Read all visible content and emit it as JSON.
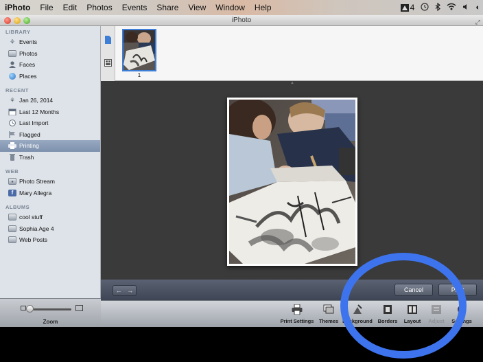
{
  "menubar": {
    "app": "iPhoto",
    "items": [
      "File",
      "Edit",
      "Photos",
      "Events",
      "Share",
      "View",
      "Window",
      "Help"
    ],
    "status_text": "4"
  },
  "window": {
    "title": "iPhoto"
  },
  "sidebar": {
    "sections": [
      {
        "heading": "LIBRARY",
        "items": [
          {
            "label": "Events",
            "icon": "palm-tree-icon"
          },
          {
            "label": "Photos",
            "icon": "photos-icon"
          },
          {
            "label": "Faces",
            "icon": "faces-icon"
          },
          {
            "label": "Places",
            "icon": "globe-icon"
          }
        ]
      },
      {
        "heading": "RECENT",
        "items": [
          {
            "label": "Jan 26, 2014",
            "icon": "palm-tree-icon"
          },
          {
            "label": "Last 12 Months",
            "icon": "calendar-icon"
          },
          {
            "label": "Last Import",
            "icon": "clock-icon"
          },
          {
            "label": "Flagged",
            "icon": "flag-icon"
          },
          {
            "label": "Printing",
            "icon": "printer-icon",
            "selected": true
          },
          {
            "label": "Trash",
            "icon": "trash-icon"
          }
        ]
      },
      {
        "heading": "WEB",
        "items": [
          {
            "label": "Photo Stream",
            "icon": "photo-stream-icon"
          },
          {
            "label": "Mary Allegra",
            "icon": "facebook-icon"
          }
        ]
      },
      {
        "heading": "ALBUMS",
        "items": [
          {
            "label": "cool stuff",
            "icon": "album-icon"
          },
          {
            "label": "Sophia Age 4",
            "icon": "album-icon"
          },
          {
            "label": "Web Posts",
            "icon": "album-icon"
          }
        ]
      }
    ],
    "zoom_label": "Zoom"
  },
  "filmstrip": {
    "thumb_number": "1"
  },
  "navbar": {
    "cancel_label": "Cancel",
    "print_label": "Print"
  },
  "toolbar": {
    "buttons": [
      {
        "label": "Print Settings",
        "icon": "printer-icon"
      },
      {
        "label": "Themes",
        "icon": "themes-icon"
      },
      {
        "label": "Background",
        "icon": "background-icon"
      },
      {
        "label": "Borders",
        "icon": "borders-icon"
      },
      {
        "label": "Layout",
        "icon": "layout-icon"
      },
      {
        "label": "Adjust",
        "icon": "adjust-icon",
        "disabled": true
      },
      {
        "label": "Settings",
        "icon": "settings-icon"
      }
    ]
  },
  "colors": {
    "accent": "#3d74ee",
    "selection": "#7d90ad"
  }
}
